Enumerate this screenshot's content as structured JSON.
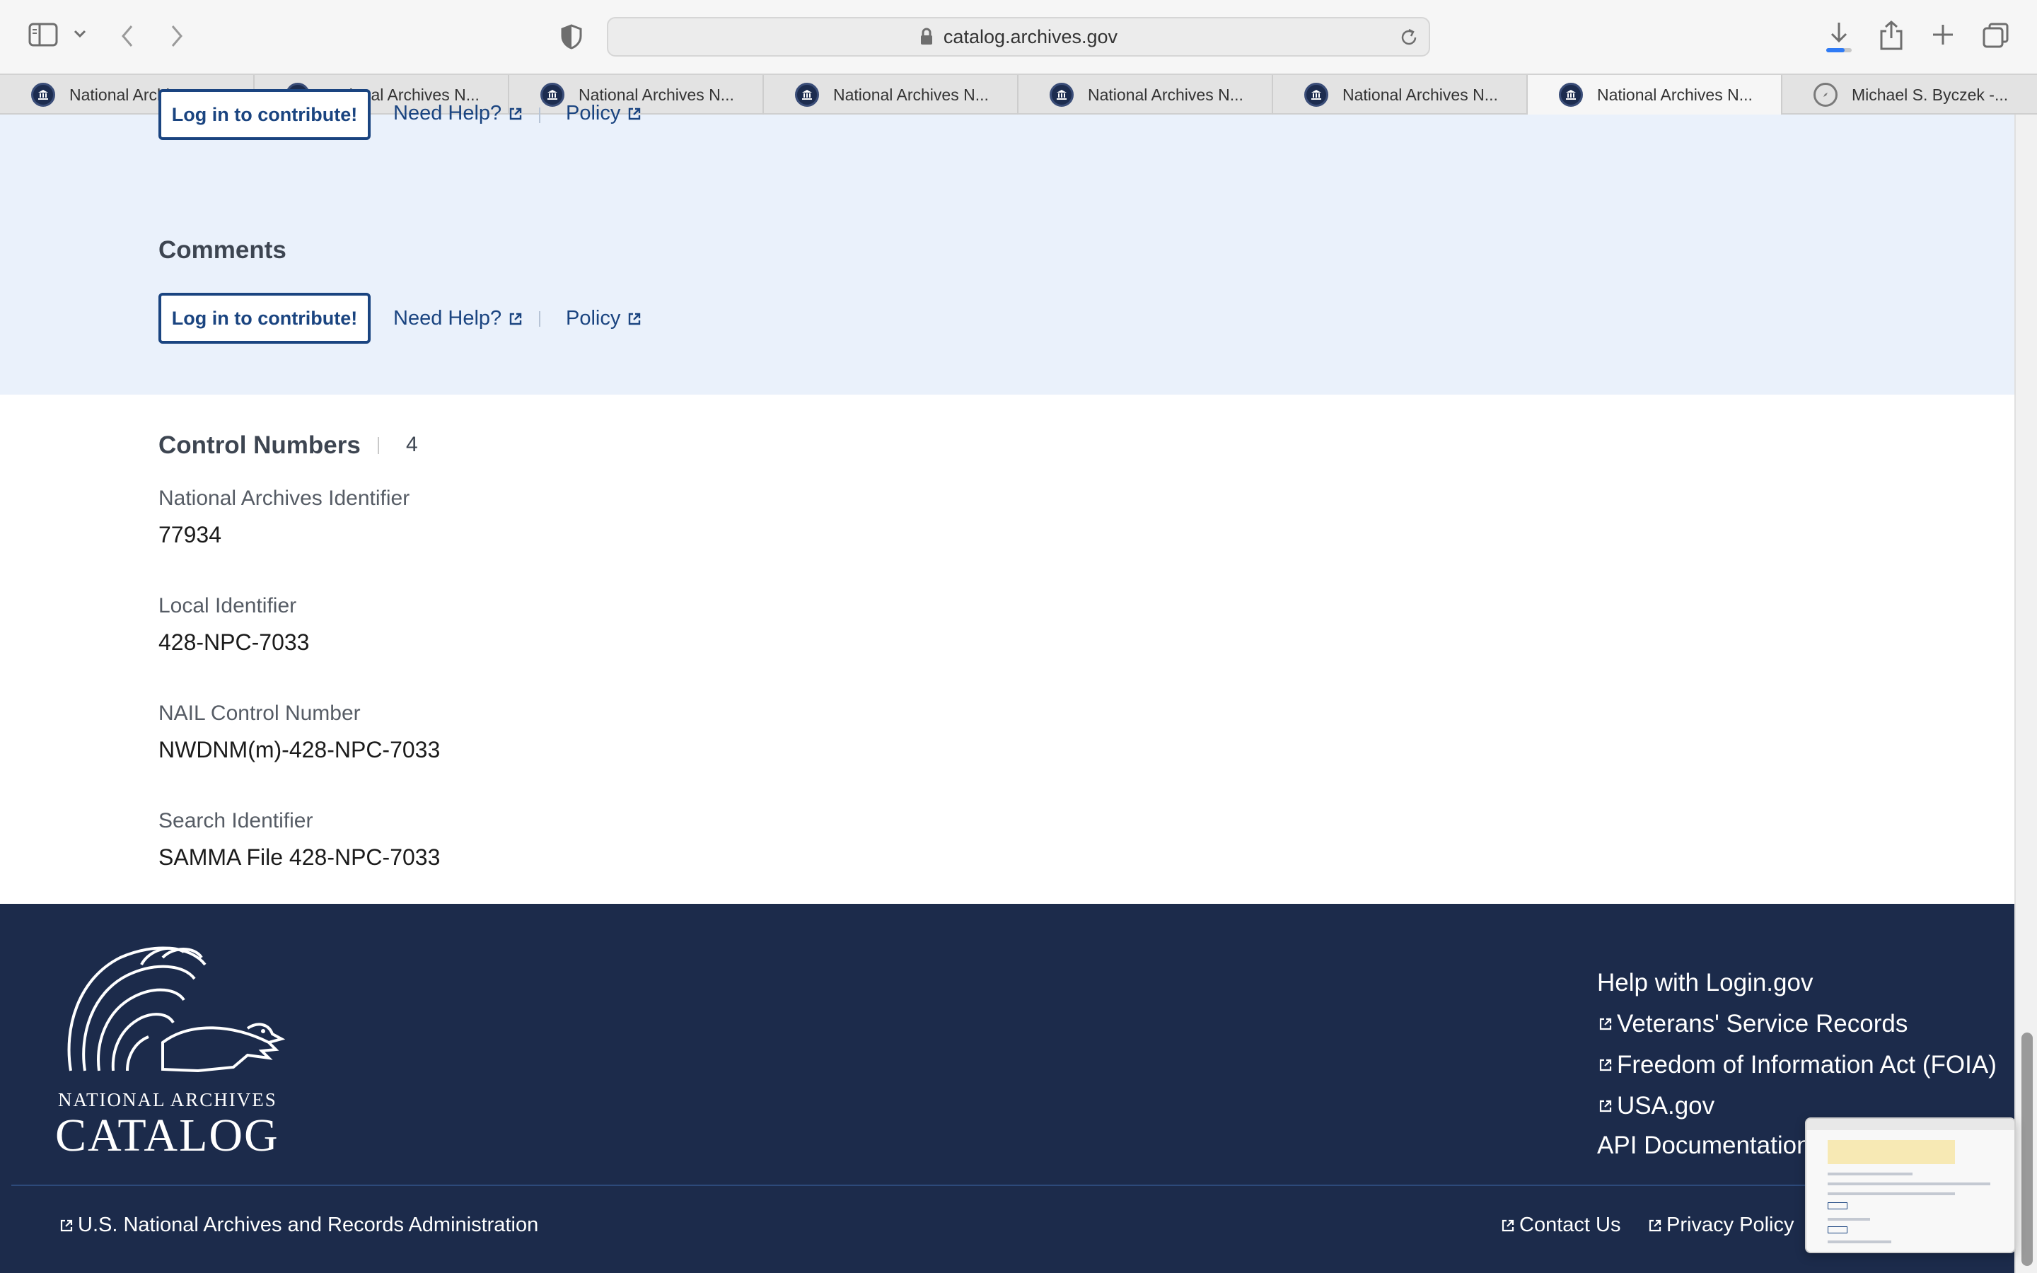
{
  "browser": {
    "url": "catalog.archives.gov",
    "tabs": [
      {
        "title": "National Archives N...",
        "icon": "archives-favicon",
        "active": false
      },
      {
        "title": "National Archives N...",
        "icon": "archives-favicon",
        "active": false
      },
      {
        "title": "National Archives N...",
        "icon": "archives-favicon",
        "active": false
      },
      {
        "title": "National Archives N...",
        "icon": "archives-favicon",
        "active": false
      },
      {
        "title": "National Archives N...",
        "icon": "archives-favicon",
        "active": false
      },
      {
        "title": "National Archives N...",
        "icon": "archives-favicon",
        "active": false
      },
      {
        "title": "National Archives N...",
        "icon": "archives-favicon",
        "active": true
      },
      {
        "title": "Michael S. Byczek -...",
        "icon": "compass-icon",
        "active": false
      }
    ]
  },
  "contribute": {
    "login_label": "Log in to contribute!",
    "help_label": "Need Help?",
    "policy_label": "Policy"
  },
  "comments": {
    "title": "Comments",
    "login_label": "Log in to contribute!",
    "help_label": "Need Help?",
    "policy_label": "Policy"
  },
  "control_numbers": {
    "title": "Control Numbers",
    "count": "4",
    "items": [
      {
        "label": "National Archives Identifier",
        "value": "77934"
      },
      {
        "label": "Local Identifier",
        "value": "428-NPC-7033"
      },
      {
        "label": "NAIL Control Number",
        "value": "NWDNM(m)-428-NPC-7033"
      },
      {
        "label": "Search Identifier",
        "value": "SAMMA File 428-NPC-7033"
      }
    ]
  },
  "footer": {
    "logo_top": "NATIONAL ARCHIVES",
    "logo_main": "CATALOG",
    "links": [
      {
        "label": "Help with Login.gov",
        "external": false
      },
      {
        "label": "Veterans' Service Records",
        "external": true
      },
      {
        "label": "Freedom of Information Act (FOIA)",
        "external": true
      },
      {
        "label": "USA.gov",
        "external": true
      },
      {
        "label": "API Documentation",
        "external": false
      }
    ],
    "bottom_left": "U.S. National Archives and Records Administration",
    "contact": "Contact Us",
    "privacy": "Privacy Policy"
  },
  "colors": {
    "primary": "#1a4480",
    "band": "#eaf1fb",
    "footer": "#1c2b4b"
  }
}
